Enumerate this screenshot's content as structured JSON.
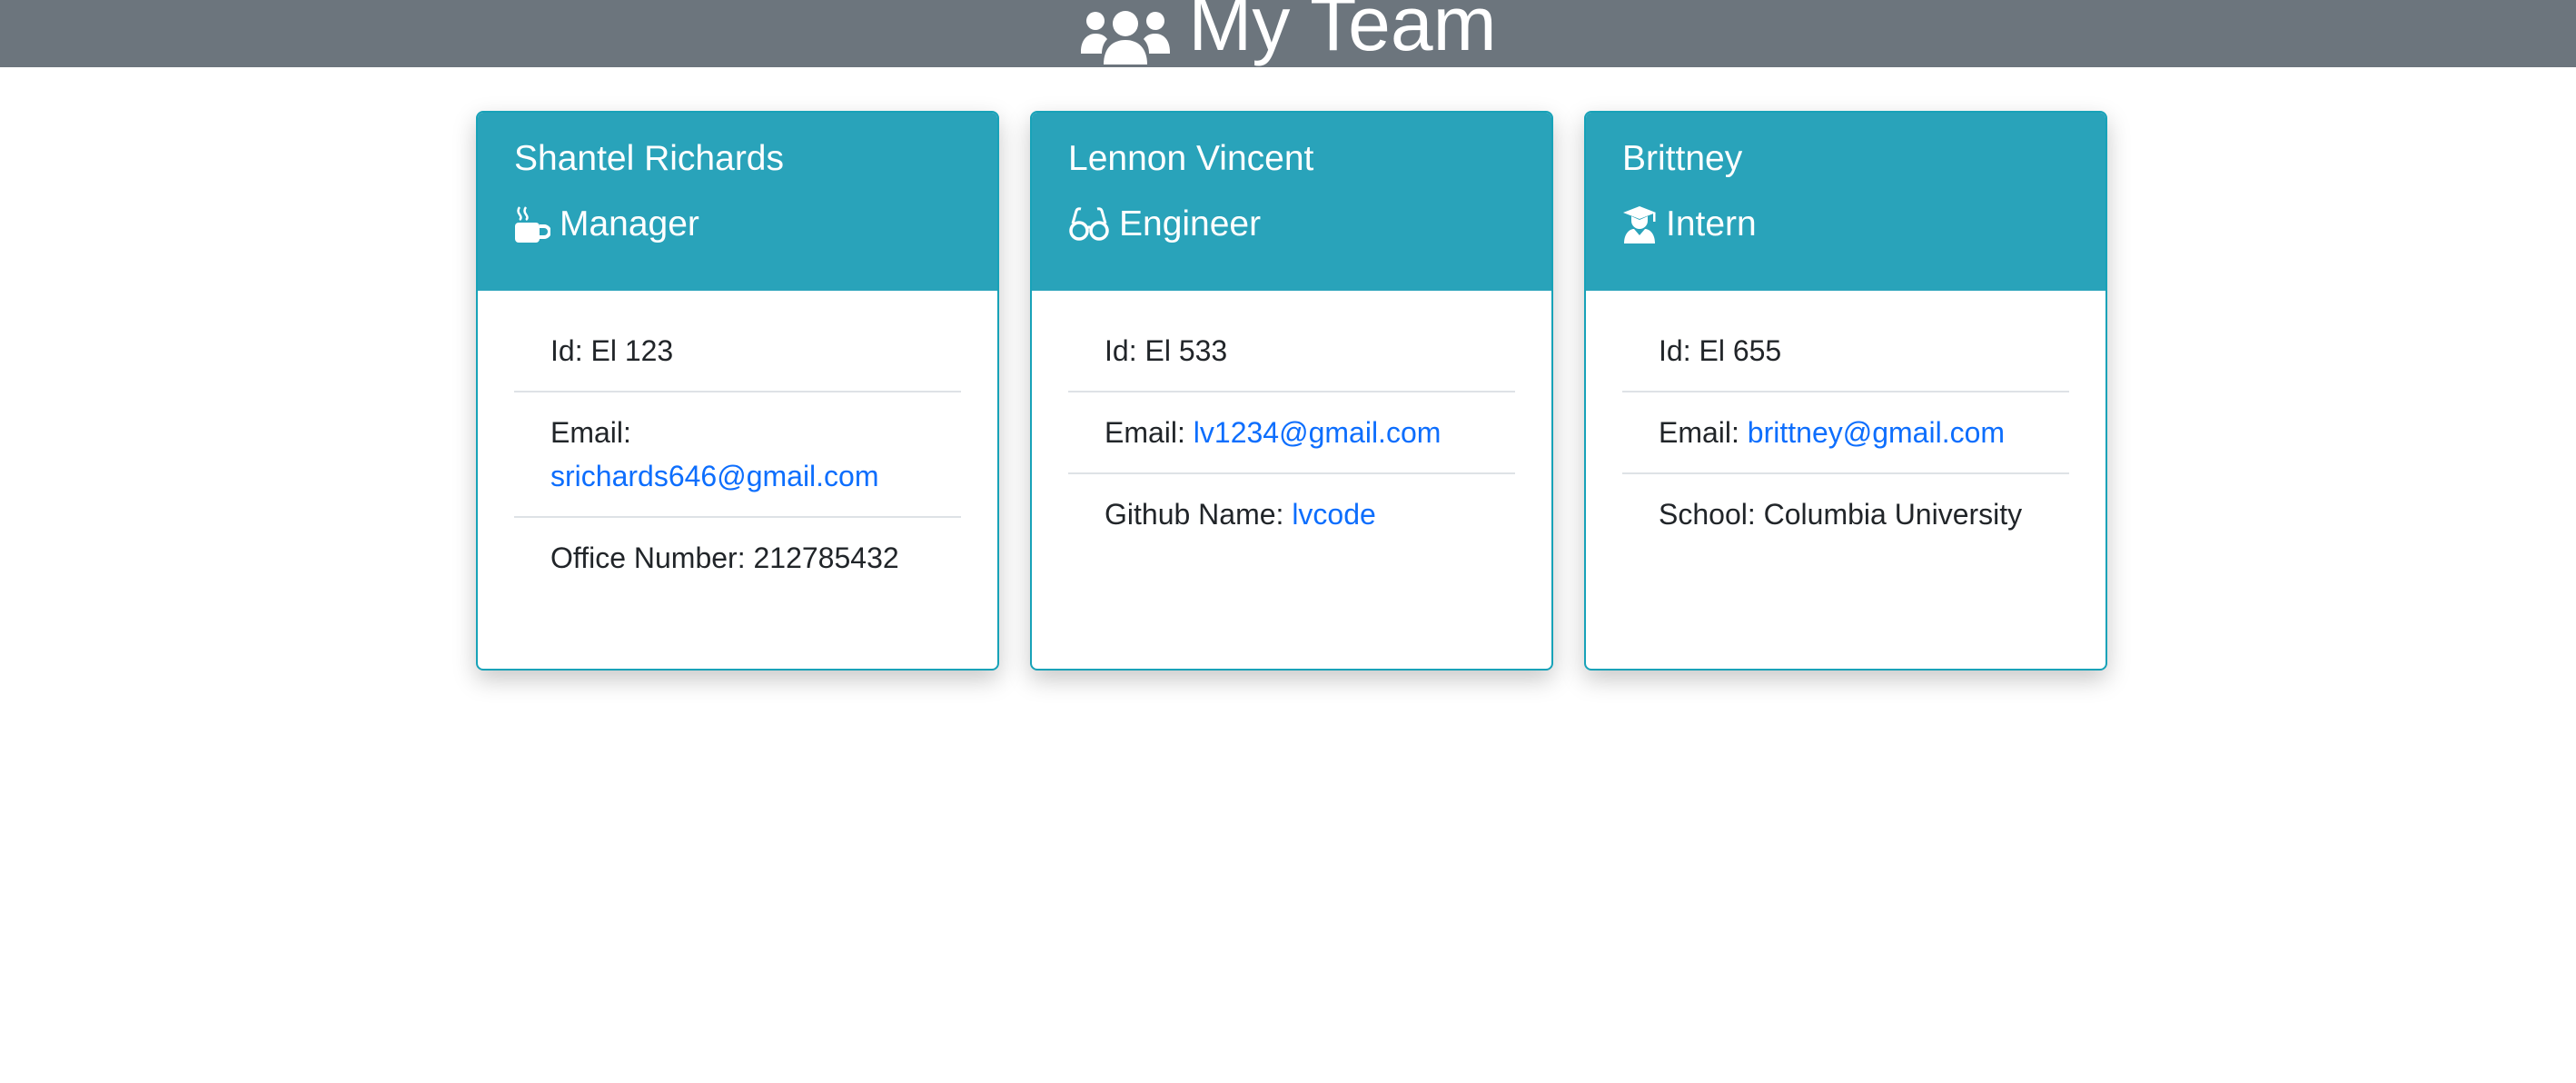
{
  "header": {
    "title": "My Team",
    "icon": "users-icon",
    "background": "#6c757d"
  },
  "colors": {
    "card_header": "#29a3ba",
    "card_border": "#17a2b8",
    "link": "#0d6efd"
  },
  "cards": [
    {
      "name": "Shantel Richards",
      "role": "Manager",
      "role_icon": "mug-hot-icon",
      "id_label": "Id:",
      "id_value": "El 123",
      "email_label": "Email:",
      "email": "srichards646@gmail.com",
      "extra_label": "Office Number:",
      "extra_value": "212785432"
    },
    {
      "name": "Lennon Vincent",
      "role": "Engineer",
      "role_icon": "glasses-icon",
      "id_label": "Id:",
      "id_value": "El 533",
      "email_label": "Email:",
      "email": "lv1234@gmail.com",
      "extra_label": "Github Name:",
      "extra_value": "lvcode"
    },
    {
      "name": "Brittney",
      "role": "Intern",
      "role_icon": "user-graduate-icon",
      "id_label": "Id:",
      "id_value": "El 655",
      "email_label": "Email:",
      "email": "brittney@gmail.com",
      "extra_label": "School:",
      "extra_value": "Columbia University"
    }
  ]
}
